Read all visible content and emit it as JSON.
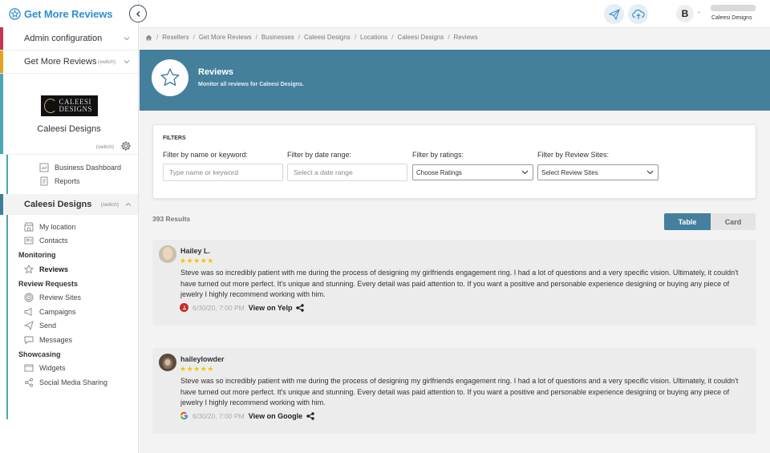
{
  "brand": {
    "name": "Get More Reviews"
  },
  "sidebar": {
    "admin_config": "Admin configuration",
    "get_more_reviews": "Get More Reviews",
    "switch_label": "(switch)",
    "business": {
      "name": "Caleesi Designs",
      "logo_line1": "CALEESI",
      "logo_line2": "DESIGNS"
    },
    "top_items": [
      {
        "label": "Business Dashboard",
        "icon": "chart-icon"
      },
      {
        "label": "Reports",
        "icon": "document-icon"
      }
    ],
    "current_business": "Caleesi Designs",
    "location_items": [
      {
        "label": "My location",
        "icon": "store-icon"
      },
      {
        "label": "Contacts",
        "icon": "contacts-icon"
      }
    ],
    "monitoring": {
      "title": "Monitoring",
      "items": [
        {
          "label": "Reviews",
          "icon": "star-icon"
        }
      ]
    },
    "review_requests": {
      "title": "Review Requests",
      "items": [
        {
          "label": "Review Sites",
          "icon": "target-icon"
        },
        {
          "label": "Campaigns",
          "icon": "megaphone-icon"
        },
        {
          "label": "Send",
          "icon": "send-icon"
        },
        {
          "label": "Messages",
          "icon": "message-icon"
        }
      ]
    },
    "showcasing": {
      "title": "Showcasing",
      "items": [
        {
          "label": "Widgets",
          "icon": "widget-icon"
        },
        {
          "label": "Social Media Sharing",
          "icon": "share-icon"
        }
      ]
    },
    "colors": {
      "admin": "#c8344f",
      "gmr": "#e3a41c",
      "biz": "#4aa8b5",
      "current": "#3e7f9a"
    }
  },
  "topbar": {
    "avatar_letter": "B",
    "dash": "-",
    "business_name": "Caleesi Designs"
  },
  "breadcrumb": [
    "Resellers",
    "Get More Reviews",
    "Businesses",
    "Caleesi Designs",
    "Locations",
    "Caleesi Designs",
    "Reviews"
  ],
  "banner": {
    "title": "Reviews",
    "subtitle": "Monitor all reviews for Caleesi Designs.",
    "color": "#44809c"
  },
  "filters": {
    "title": "FILTERS",
    "keyword": {
      "label": "Filter by name or keyword:",
      "placeholder": "Type name or keyword"
    },
    "date": {
      "label": "Filter by date range:",
      "placeholder": "Select a date range"
    },
    "ratings": {
      "label": "Filter by ratings:",
      "value": "Choose Ratings"
    },
    "sites": {
      "label": "Filter by Review Sites:",
      "value": "Select Review Sites"
    }
  },
  "results": {
    "count_text": "393 Results"
  },
  "view_toggle": {
    "table": "Table",
    "card": "Card",
    "active": "Table"
  },
  "reviews": [
    {
      "name": "Hailey L.",
      "stars": "★★★★★",
      "rating": 5,
      "text": "Steve was so incredibly patient with me during the process of designing my girlfriends engagement ring. I had a lot of questions and a very specific vision. Ultimately, it couldn't have turned out more perfect. It's unique and stunning. Every detail was paid attention to. If you want a positive and personable experience designing or buying any piece of jewelry I highly recommend working with him.",
      "date": "6/30/20, 7:00 PM",
      "link": "View on Yelp",
      "site": "yelp"
    },
    {
      "name": "haileylowder",
      "stars": "★★★★★",
      "rating": 5,
      "text": "Steve was so incredibly patient with me during the process of designing my girlfriends engagement ring. I had a lot of questions and a very specific vision. Ultimately, it couldn't have turned out more perfect. It's unique and stunning. Every detail was paid attention to. If you want a positive and personable experience designing or buying any piece of jewelry I highly recommend working with him.",
      "date": "6/30/20, 7:00 PM",
      "link": "View on Google",
      "site": "google"
    }
  ]
}
